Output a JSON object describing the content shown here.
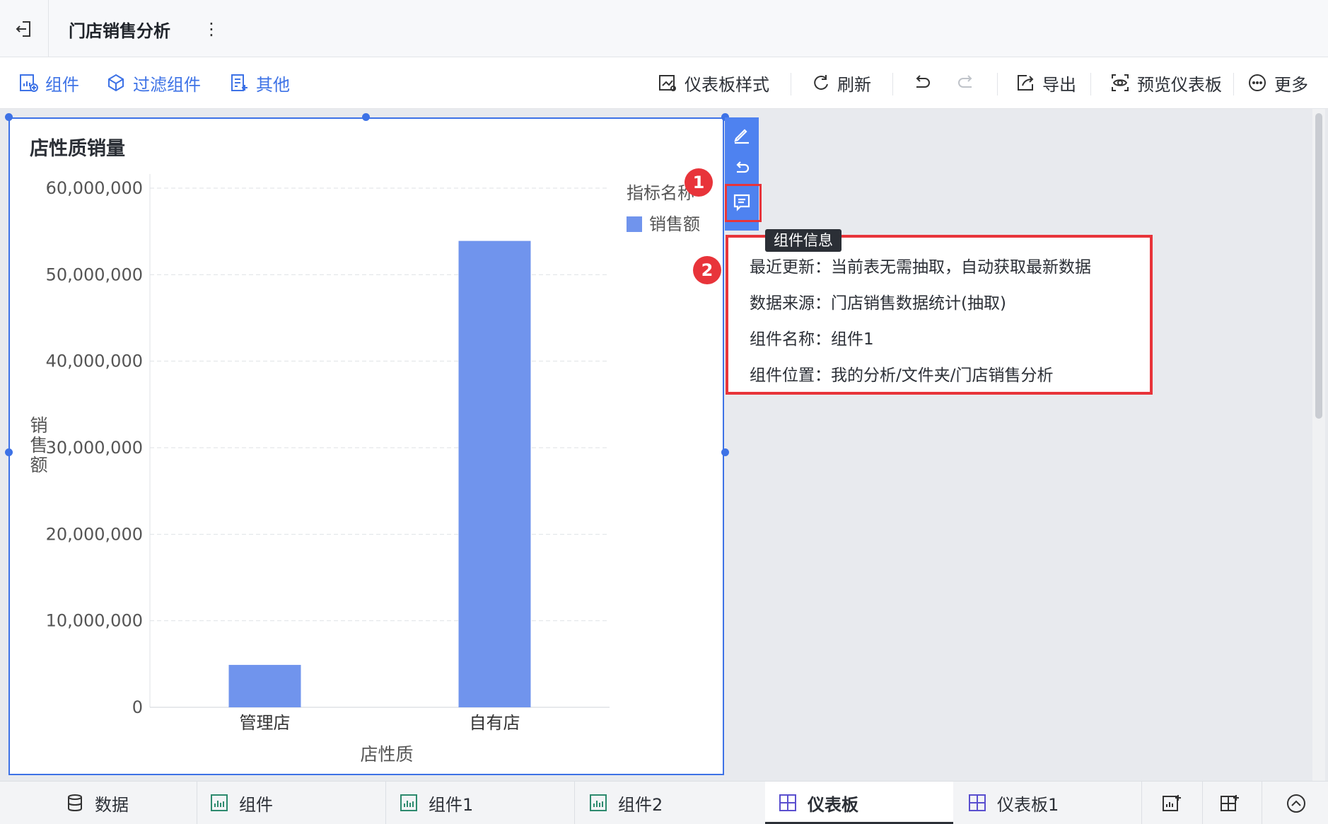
{
  "app": {
    "title": "门店销售分析"
  },
  "toolbar": {
    "left": [
      {
        "label": "组件",
        "icon": "add-chart-icon"
      },
      {
        "label": "过滤组件",
        "icon": "filter-component-icon"
      },
      {
        "label": "其他",
        "icon": "other-icon"
      }
    ],
    "right": {
      "style_label": "仪表板样式",
      "refresh_label": "刷新",
      "export_label": "导出",
      "preview_label": "预览仪表板",
      "more_label": "更多"
    }
  },
  "widget": {
    "title": "店性质销量",
    "tooltip": "组件信息",
    "badges": [
      "1",
      "2"
    ],
    "info": [
      {
        "key": "最近更新：",
        "value": "当前表无需抽取，自动获取最新数据"
      },
      {
        "key": "数据来源：",
        "value": "门店销售数据统计(抽取)"
      },
      {
        "key": "组件名称：",
        "value": "组件1"
      },
      {
        "key": "组件位置：",
        "value": "我的分析/文件夹/门店销售分析"
      }
    ]
  },
  "chart_data": {
    "type": "bar",
    "categories": [
      "管理店",
      "自有店"
    ],
    "series": [
      {
        "name": "销售额",
        "values": [
          4900000,
          53900000
        ],
        "color": "#7094ed"
      }
    ],
    "xlabel": "店性质",
    "ylabel": "销售额",
    "ylim": [
      0,
      60000000
    ],
    "yticks": [
      0,
      10000000,
      20000000,
      30000000,
      40000000,
      50000000,
      60000000
    ],
    "ytick_labels": [
      "0",
      "10,000,000",
      "20,000,000",
      "30,000,000",
      "40,000,000",
      "50,000,000",
      "60,000,000"
    ],
    "legend_title": "指标名称",
    "legend_position": "top-right",
    "grid": true
  },
  "bottom_tabs": [
    {
      "label": "数据",
      "icon": "database-icon",
      "active": false
    },
    {
      "label": "组件",
      "icon": "bar-chart-icon",
      "active": false
    },
    {
      "label": "组件1",
      "icon": "bar-chart-icon",
      "active": false
    },
    {
      "label": "组件2",
      "icon": "bar-chart-icon",
      "active": false
    },
    {
      "label": "仪表板",
      "icon": "dashboard-icon",
      "active": true
    },
    {
      "label": "仪表板1",
      "icon": "dashboard-icon",
      "active": false
    }
  ],
  "colors": {
    "accent": "#3d72e6",
    "bar": "#7094ed",
    "highlight": "#e8343a"
  }
}
